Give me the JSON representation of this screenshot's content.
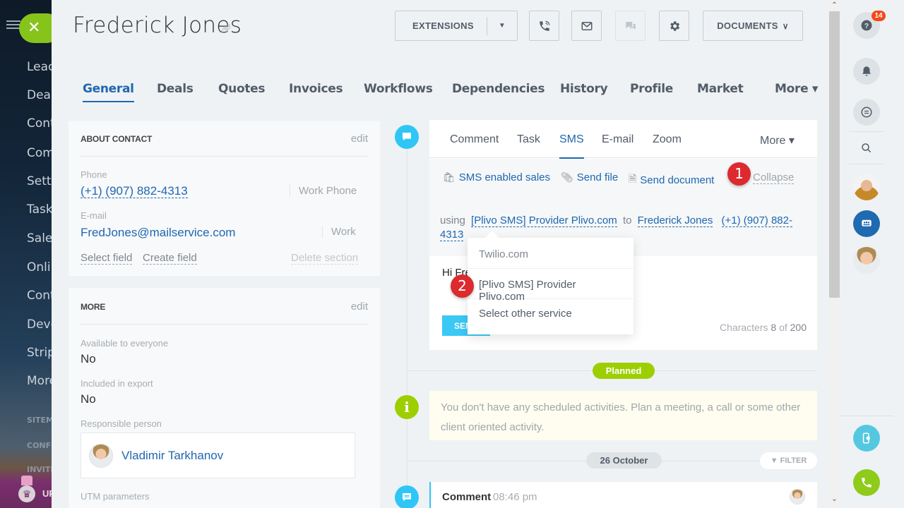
{
  "left_nav": {
    "items": [
      {
        "label": "Leac",
        "active": false
      },
      {
        "label": "Deal",
        "active": false
      },
      {
        "label": "Cont",
        "active": true
      },
      {
        "label": "Com",
        "active": false
      },
      {
        "label": "Setti",
        "active": false
      },
      {
        "label": "Task",
        "active": false
      },
      {
        "label": "Sales",
        "active": false
      },
      {
        "label": "Onlir",
        "active": false
      },
      {
        "label": "Cont",
        "active": false
      },
      {
        "label": "Deve",
        "active": false
      },
      {
        "label": "Strip",
        "active": false
      },
      {
        "label": "More",
        "active": false
      }
    ],
    "small_items": [
      "SITEMA",
      "CONFI",
      "INVITE"
    ],
    "upgrade_label": "UP",
    "close_icon": "close-icon",
    "accent_color": "#86c41c"
  },
  "header": {
    "title": "Frederick  Jones",
    "extensions_label": "EXTENSIONS",
    "documents_label": "DOCUMENTS",
    "icon_buttons": [
      "phone-icon",
      "mail-icon",
      "chat-icon",
      "gear-icon"
    ]
  },
  "tabs": [
    {
      "label": "General",
      "active": true
    },
    {
      "label": "Deals"
    },
    {
      "label": "Quotes"
    },
    {
      "label": "Invoices"
    },
    {
      "label": "Workflows"
    },
    {
      "label": "Dependencies"
    },
    {
      "label": "History"
    },
    {
      "label": "Profile"
    },
    {
      "label": "Market"
    },
    {
      "label": "More ▾"
    }
  ],
  "about_contact": {
    "title": "ABOUT CONTACT",
    "edit": "edit",
    "phone_label": "Phone",
    "phone_value": "(+1) (907) 882-4313",
    "phone_type": "Work Phone",
    "email_label": "E-mail",
    "email_value": "FredJones@mailservice.com",
    "email_type": "Work",
    "select_field": "Select field",
    "create_field": "Create field",
    "delete_section": "Delete section"
  },
  "more_section": {
    "title": "MORE",
    "edit": "edit",
    "available_label": "Available to everyone",
    "available_value": "No",
    "export_label": "Included in export",
    "export_value": "No",
    "responsible_label": "Responsible person",
    "responsible_name": "Vladimir Tarkhanov",
    "utm_label": "UTM parameters"
  },
  "editor": {
    "tabs": [
      {
        "label": "Comment"
      },
      {
        "label": "Task"
      },
      {
        "label": "SMS",
        "active": true
      },
      {
        "label": "E-mail"
      },
      {
        "label": "Zoom"
      },
      {
        "label": "More ▾"
      }
    ],
    "sms_enabled_sales": "SMS enabled sales",
    "send_file": "Send file",
    "send_document": "Send document",
    "collapse": "Collapse",
    "using_prefix": "using",
    "provider": "[Plivo SMS] Provider Plivo.com",
    "to_word": "to",
    "recipient": "Frederick Jones",
    "recipient_phone": "(+1) (907) 882-4313",
    "message_text": "Hi Fre",
    "send_label": "SEND",
    "characters_label": "Characters",
    "characters_count": "8",
    "characters_of": "of",
    "characters_max": "200"
  },
  "provider_dropdown": {
    "items": [
      "Twilio.com",
      "[Plivo SMS] Provider Plivo.com",
      "Select other service"
    ]
  },
  "annotations": [
    "1",
    "2"
  ],
  "timeline": {
    "planned_label": "Planned",
    "empty_message": "You don't have any scheduled activities. Plan a meeting, a call or some other client oriented activity.",
    "date_label": "26 October",
    "filter_label": "FILTER",
    "comment_title": "Comment",
    "comment_time": "08:46 pm"
  },
  "right_sidebar": {
    "help_badge": "14",
    "items": [
      "help-icon",
      "bell-icon",
      "chat-feed-icon",
      "search-icon",
      "user-avatar",
      "group-chat-icon",
      "user-avatar",
      "mobile-cloud-icon",
      "phone-call-icon"
    ]
  }
}
